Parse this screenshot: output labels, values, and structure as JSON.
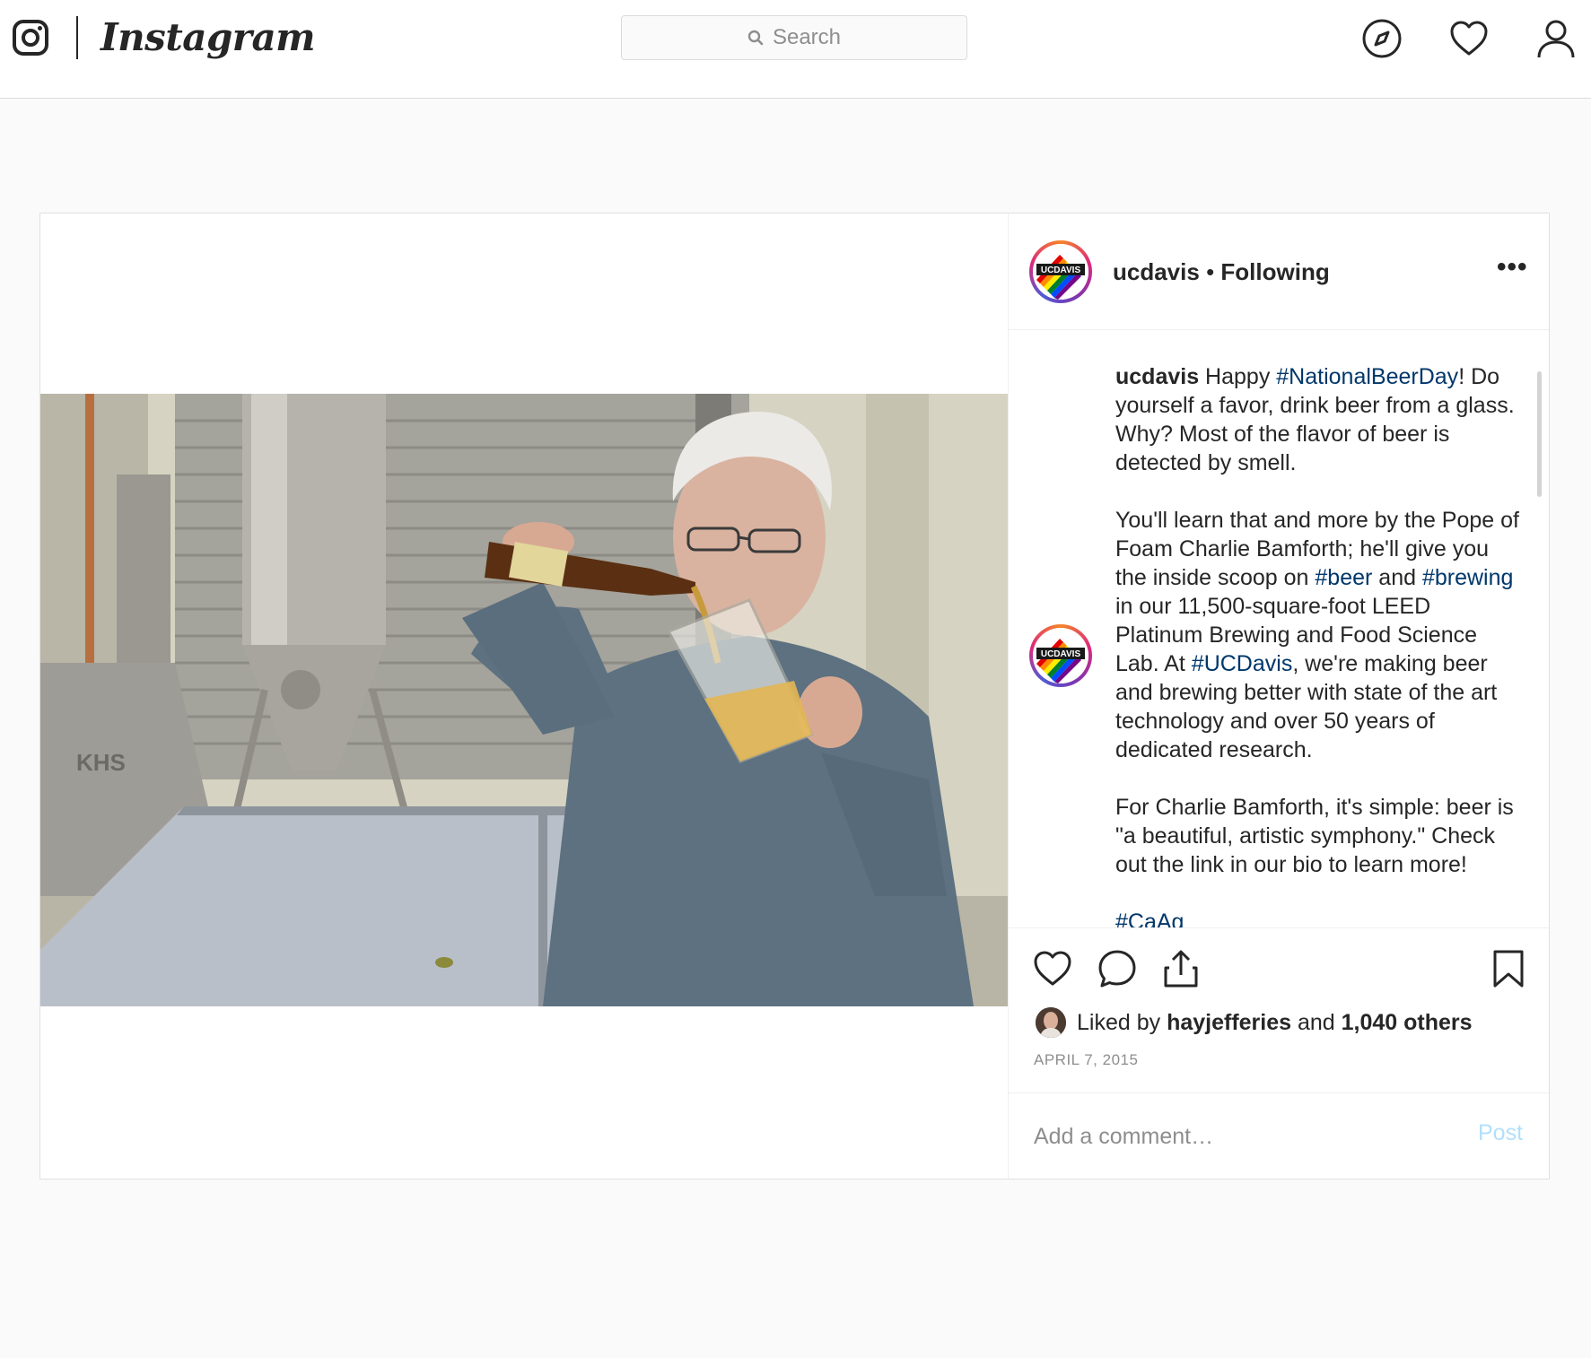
{
  "app": {
    "wordmark": "Instagram",
    "brand_color": "#262626"
  },
  "nav": {
    "search_placeholder": "Search",
    "icons": [
      "instagram-glyph-icon",
      "search-icon",
      "explore-compass-icon",
      "activity-heart-icon",
      "profile-icon"
    ]
  },
  "post": {
    "username": "ucdavis",
    "separator": "•",
    "follow_status": "Following",
    "more_label": "•••",
    "avatar_text": "UCDAVIS",
    "caption": {
      "username": "ucdavis",
      "p1_a": " Happy ",
      "p1_tag": "#NationalBeerDay",
      "p1_b": "! Do yourself a favor, drink beer from a glass. Why? Most of the flavor of beer is detected by smell.",
      "p2_a": "You'll learn that and more by the Pope of Foam Charlie Bamforth; he'll give you the inside scoop on ",
      "p2_tag1": "#beer",
      "p2_b": " and ",
      "p2_tag2": "#brewing",
      "p2_c": " in our 11,500-square-foot LEED Platinum Brewing and Food Science Lab. At ",
      "p2_tag3": "#UCDavis",
      "p2_d": ", we're making beer and brewing better with state of the art technology and over 50 years of dedicated research.",
      "p3": "For Charlie Bamforth, it's simple: beer is \"a beautiful, artistic symphony.\" Check out the link in our bio to learn more!",
      "p4_tag": "#CaAg"
    },
    "tag_color": "#00376b",
    "likes": {
      "prefix": "Liked by ",
      "user": "hayjefferies",
      "middle": " and ",
      "others": "1,040 others"
    },
    "date": "APRIL 7, 2015",
    "comment_placeholder": "Add a comment…",
    "post_button": "Post"
  }
}
